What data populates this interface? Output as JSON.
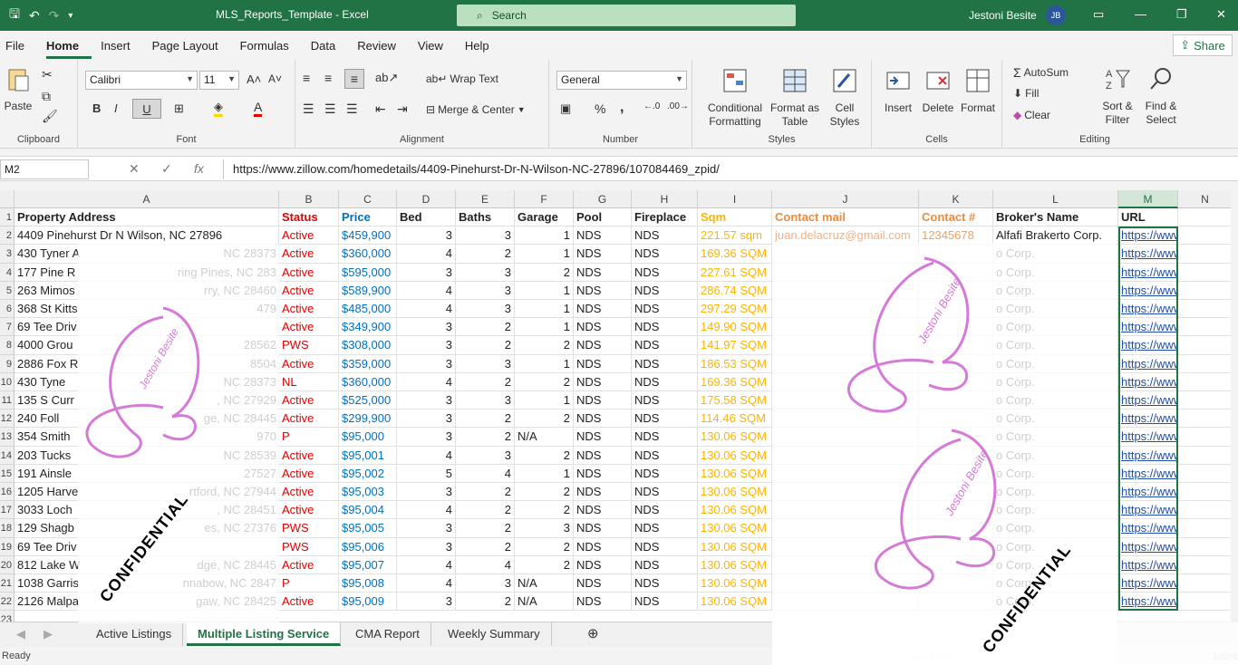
{
  "window": {
    "doc_title": "MLS_Reports_Template  -  Excel",
    "search_placeholder": "Search",
    "user_name": "Jestoni Besite",
    "user_initials": "JB"
  },
  "menu": {
    "tabs": [
      "File",
      "Home",
      "Insert",
      "Page Layout",
      "Formulas",
      "Data",
      "Review",
      "View",
      "Help"
    ],
    "active": "Home",
    "share": "Share"
  },
  "ribbon": {
    "clipboard": {
      "label": "Clipboard",
      "paste": "Paste"
    },
    "font": {
      "label": "Font",
      "name": "Calibri",
      "size": "11",
      "bold": "B",
      "italic": "I",
      "underline": "U"
    },
    "alignment": {
      "label": "Alignment",
      "wrap": "Wrap Text",
      "merge": "Merge & Center"
    },
    "number": {
      "label": "Number",
      "format": "General"
    },
    "styles": {
      "label": "Styles",
      "conditional": "Conditional Formatting",
      "format_table": "Format as Table",
      "cell_styles": "Cell Styles"
    },
    "cells": {
      "label": "Cells",
      "insert": "Insert",
      "delete": "Delete",
      "format": "Format"
    },
    "editing": {
      "label": "Editing",
      "autosum": "AutoSum",
      "fill": "Fill",
      "clear": "Clear",
      "sort": "Sort & Filter",
      "find": "Find & Select"
    }
  },
  "formula_bar": {
    "name_box": "M2",
    "formula": "https://www.zillow.com/homedetails/4409-Pinehurst-Dr-N-Wilson-NC-27896/107084469_zpid/"
  },
  "columns": [
    "A",
    "B",
    "C",
    "D",
    "E",
    "F",
    "G",
    "H",
    "I",
    "J",
    "K",
    "L",
    "M",
    "N"
  ],
  "headers": {
    "address": "Property Address",
    "status": "Status",
    "price": "Price",
    "bed": "Bed",
    "baths": "Baths",
    "garage": "Garage",
    "pool": "Pool",
    "fireplace": "Fireplace",
    "sqm": "Sqm",
    "mail": "Contact mail",
    "contact": "Contact #",
    "broker": "Broker's Name",
    "url": "URL"
  },
  "rows": [
    {
      "n": "2",
      "address": "4409 Pinehurst Dr N Wilson, NC 27896",
      "status": "Active",
      "price": "$459,900",
      "bed": "3",
      "baths": "3",
      "garage": "1",
      "pool": "NDS",
      "fireplace": "NDS",
      "sqm": "221.57 sqm",
      "mail": "juan.delacruz@gmail.com",
      "contact": "12345678",
      "broker": "Alfafi Brakerto Corp.",
      "url": "https://www.zillow/"
    },
    {
      "n": "3",
      "address": "430 Tyner A",
      "status": "Active",
      "price": "$360,000",
      "bed": "4",
      "baths": "2",
      "garage": "1",
      "pool": "NDS",
      "fireplace": "NDS",
      "sqm": "169.36 SQM",
      "mail": "",
      "contact": "",
      "broker": "o Corp.",
      "url": "https://www."
    },
    {
      "n": "4",
      "address": "177 Pine R",
      "status": "Active",
      "price": "$595,000",
      "bed": "3",
      "baths": "3",
      "garage": "2",
      "pool": "NDS",
      "fireplace": "NDS",
      "sqm": "227.61 SQM",
      "mail": "",
      "contact": "",
      "broker": "o Corp.",
      "url": "https://www."
    },
    {
      "n": "5",
      "address": "263 Mimos",
      "status": "Active",
      "price": "$589,900",
      "bed": "4",
      "baths": "3",
      "garage": "1",
      "pool": "NDS",
      "fireplace": "NDS",
      "sqm": "286.74 SQM",
      "mail": "",
      "contact": "",
      "broker": "o Corp.",
      "url": "https://www."
    },
    {
      "n": "6",
      "address": "368 St Kitts",
      "status": "Active",
      "price": "$485,000",
      "bed": "4",
      "baths": "3",
      "garage": "1",
      "pool": "NDS",
      "fireplace": "NDS",
      "sqm": "297.29 SQM",
      "mail": "",
      "contact": "",
      "broker": "o Corp.",
      "url": "https://www."
    },
    {
      "n": "7",
      "address": "69 Tee Driv",
      "status": "Active",
      "price": "$349,900",
      "bed": "3",
      "baths": "2",
      "garage": "1",
      "pool": "NDS",
      "fireplace": "NDS",
      "sqm": "149.90 SQM",
      "mail": "",
      "contact": "",
      "broker": "o Corp.",
      "url": "https://www."
    },
    {
      "n": "8",
      "address": " 4000 Grou",
      "status": "PWS",
      "price": "$308,000",
      "bed": "3",
      "baths": "2",
      "garage": "2",
      "pool": "NDS",
      "fireplace": "NDS",
      "sqm": "141.97 SQM",
      "mail": "",
      "contact": "",
      "broker": "o Corp.",
      "url": "https://www."
    },
    {
      "n": "9",
      "address": "2886 Fox R",
      "status": "Active",
      "price": "$359,000",
      "bed": "3",
      "baths": "3",
      "garage": "1",
      "pool": "NDS",
      "fireplace": "NDS",
      "sqm": "186.53 SQM",
      "mail": "",
      "contact": "",
      "broker": "o Corp.",
      "url": "https://www."
    },
    {
      "n": "10",
      "address": "430 Tyne",
      "status": "NL",
      "price": "$360,000",
      "bed": "4",
      "baths": "2",
      "garage": "2",
      "pool": "NDS",
      "fireplace": "NDS",
      "sqm": "169.36 SQM",
      "mail": "",
      "contact": "",
      "broker": "o Corp.",
      "url": "https://www."
    },
    {
      "n": "11",
      "address": "135 S Curr",
      "status": "Active",
      "price": "$525,000",
      "bed": "3",
      "baths": "3",
      "garage": "1",
      "pool": "NDS",
      "fireplace": "NDS",
      "sqm": "175.58 SQM",
      "mail": "",
      "contact": "",
      "broker": "o Corp.",
      "url": "https://www."
    },
    {
      "n": "12",
      "address": "240 Foll",
      "status": "Active",
      "price": "$299,900",
      "bed": "3",
      "baths": "2",
      "garage": "2",
      "pool": "NDS",
      "fireplace": "NDS",
      "sqm": "114.46 SQM",
      "mail": "",
      "contact": "",
      "broker": "o Corp.",
      "url": "https://www."
    },
    {
      "n": "13",
      "address": "354 Smith",
      "status": "P",
      "price": "$95,000",
      "bed": "3",
      "baths": "2",
      "garage": "N/A",
      "pool": "NDS",
      "fireplace": "NDS",
      "sqm": "130.06 SQM",
      "mail": "",
      "contact": "",
      "broker": "o Corp.",
      "url": "https://www."
    },
    {
      "n": "14",
      "address": "203 Tucks",
      "status": "Active",
      "price": "$95,001",
      "bed": "4",
      "baths": "3",
      "garage": "2",
      "pool": "NDS",
      "fireplace": "NDS",
      "sqm": "130.06 SQM",
      "mail": "",
      "contact": "",
      "broker": "o Corp.",
      "url": "https://www."
    },
    {
      "n": "15",
      "address": "191 Ainsle",
      "status": "Active",
      "price": "$95,002",
      "bed": "5",
      "baths": "4",
      "garage": "1",
      "pool": "NDS",
      "fireplace": "NDS",
      "sqm": "130.06 SQM",
      "mail": "",
      "contact": "",
      "broker": "o Corp.",
      "url": "https://www."
    },
    {
      "n": "16",
      "address": "1205 Harve",
      "status": "Active",
      "price": "$95,003",
      "bed": "3",
      "baths": "2",
      "garage": "2",
      "pool": "NDS",
      "fireplace": "NDS",
      "sqm": "130.06 SQM",
      "mail": "",
      "contact": "",
      "broker": "o Corp.",
      "url": "https://www."
    },
    {
      "n": "17",
      "address": "3033 Loch",
      "status": "Active",
      "price": "$95,004",
      "bed": "4",
      "baths": "2",
      "garage": "2",
      "pool": "NDS",
      "fireplace": "NDS",
      "sqm": "130.06 SQM",
      "mail": "",
      "contact": "",
      "broker": "o Corp.",
      "url": "https://www."
    },
    {
      "n": "18",
      "address": "129 Shagb",
      "status": "PWS",
      "price": "$95,005",
      "bed": "3",
      "baths": "2",
      "garage": "3",
      "pool": "NDS",
      "fireplace": "NDS",
      "sqm": "130.06 SQM",
      "mail": "",
      "contact": "",
      "broker": "o Corp.",
      "url": "https://www."
    },
    {
      "n": "19",
      "address": "69 Tee Driv",
      "status": "PWS",
      "price": "$95,006",
      "bed": "3",
      "baths": "2",
      "garage": "2",
      "pool": "NDS",
      "fireplace": "NDS",
      "sqm": "130.06 SQM",
      "mail": "",
      "contact": "",
      "broker": "o Corp.",
      "url": "https://www."
    },
    {
      "n": "20",
      "address": "812 Lake W",
      "status": "Active",
      "price": "$95,007",
      "bed": "4",
      "baths": "4",
      "garage": "2",
      "pool": "NDS",
      "fireplace": "NDS",
      "sqm": "130.06 SQM",
      "mail": "",
      "contact": "",
      "broker": "o Corp.",
      "url": "https://www."
    },
    {
      "n": "21",
      "address": "1038 Garris",
      "status": "P",
      "price": "$95,008",
      "bed": "4",
      "baths": "3",
      "garage": "N/A",
      "pool": "NDS",
      "fireplace": "NDS",
      "sqm": "130.06 SQM",
      "mail": "",
      "contact": "",
      "broker": "o Corp.",
      "url": "https://www."
    },
    {
      "n": "22",
      "address": "2126 Malpa",
      "status": "Active",
      "price": "$95,009",
      "bed": "3",
      "baths": "2",
      "garage": "N/A",
      "pool": "NDS",
      "fireplace": "NDS",
      "sqm": "130.06 SQM",
      "mail": "",
      "contact": "",
      "broker": "o Corp.",
      "url": "https://www."
    }
  ],
  "address_tails": [
    "",
    "NC 28373",
    "ring Pines, NC 283",
    "rry, NC 28460",
    "479",
    "",
    "28562",
    "8504",
    "NC 28373",
    ", NC 27929",
    "ge, NC 28445",
    "970",
    "NC 28539",
    "27527",
    "rtford, NC 27944",
    ", NC 28451",
    "es, NC 27376",
    "",
    "dge, NC 28445",
    "nnabow, NC 2847",
    "gaw, NC 28425"
  ],
  "watermark": {
    "text": "CONFIDENTIAL",
    "signature": "Jestoni Besite"
  },
  "sheets": [
    "Active Listings",
    "Multiple Listing Service",
    "CMA Report",
    "Weekly Summary"
  ],
  "active_sheet": "Multiple Listing Service",
  "status": {
    "ready": "Ready",
    "count": "Count: 21",
    "zoom": "100%"
  }
}
